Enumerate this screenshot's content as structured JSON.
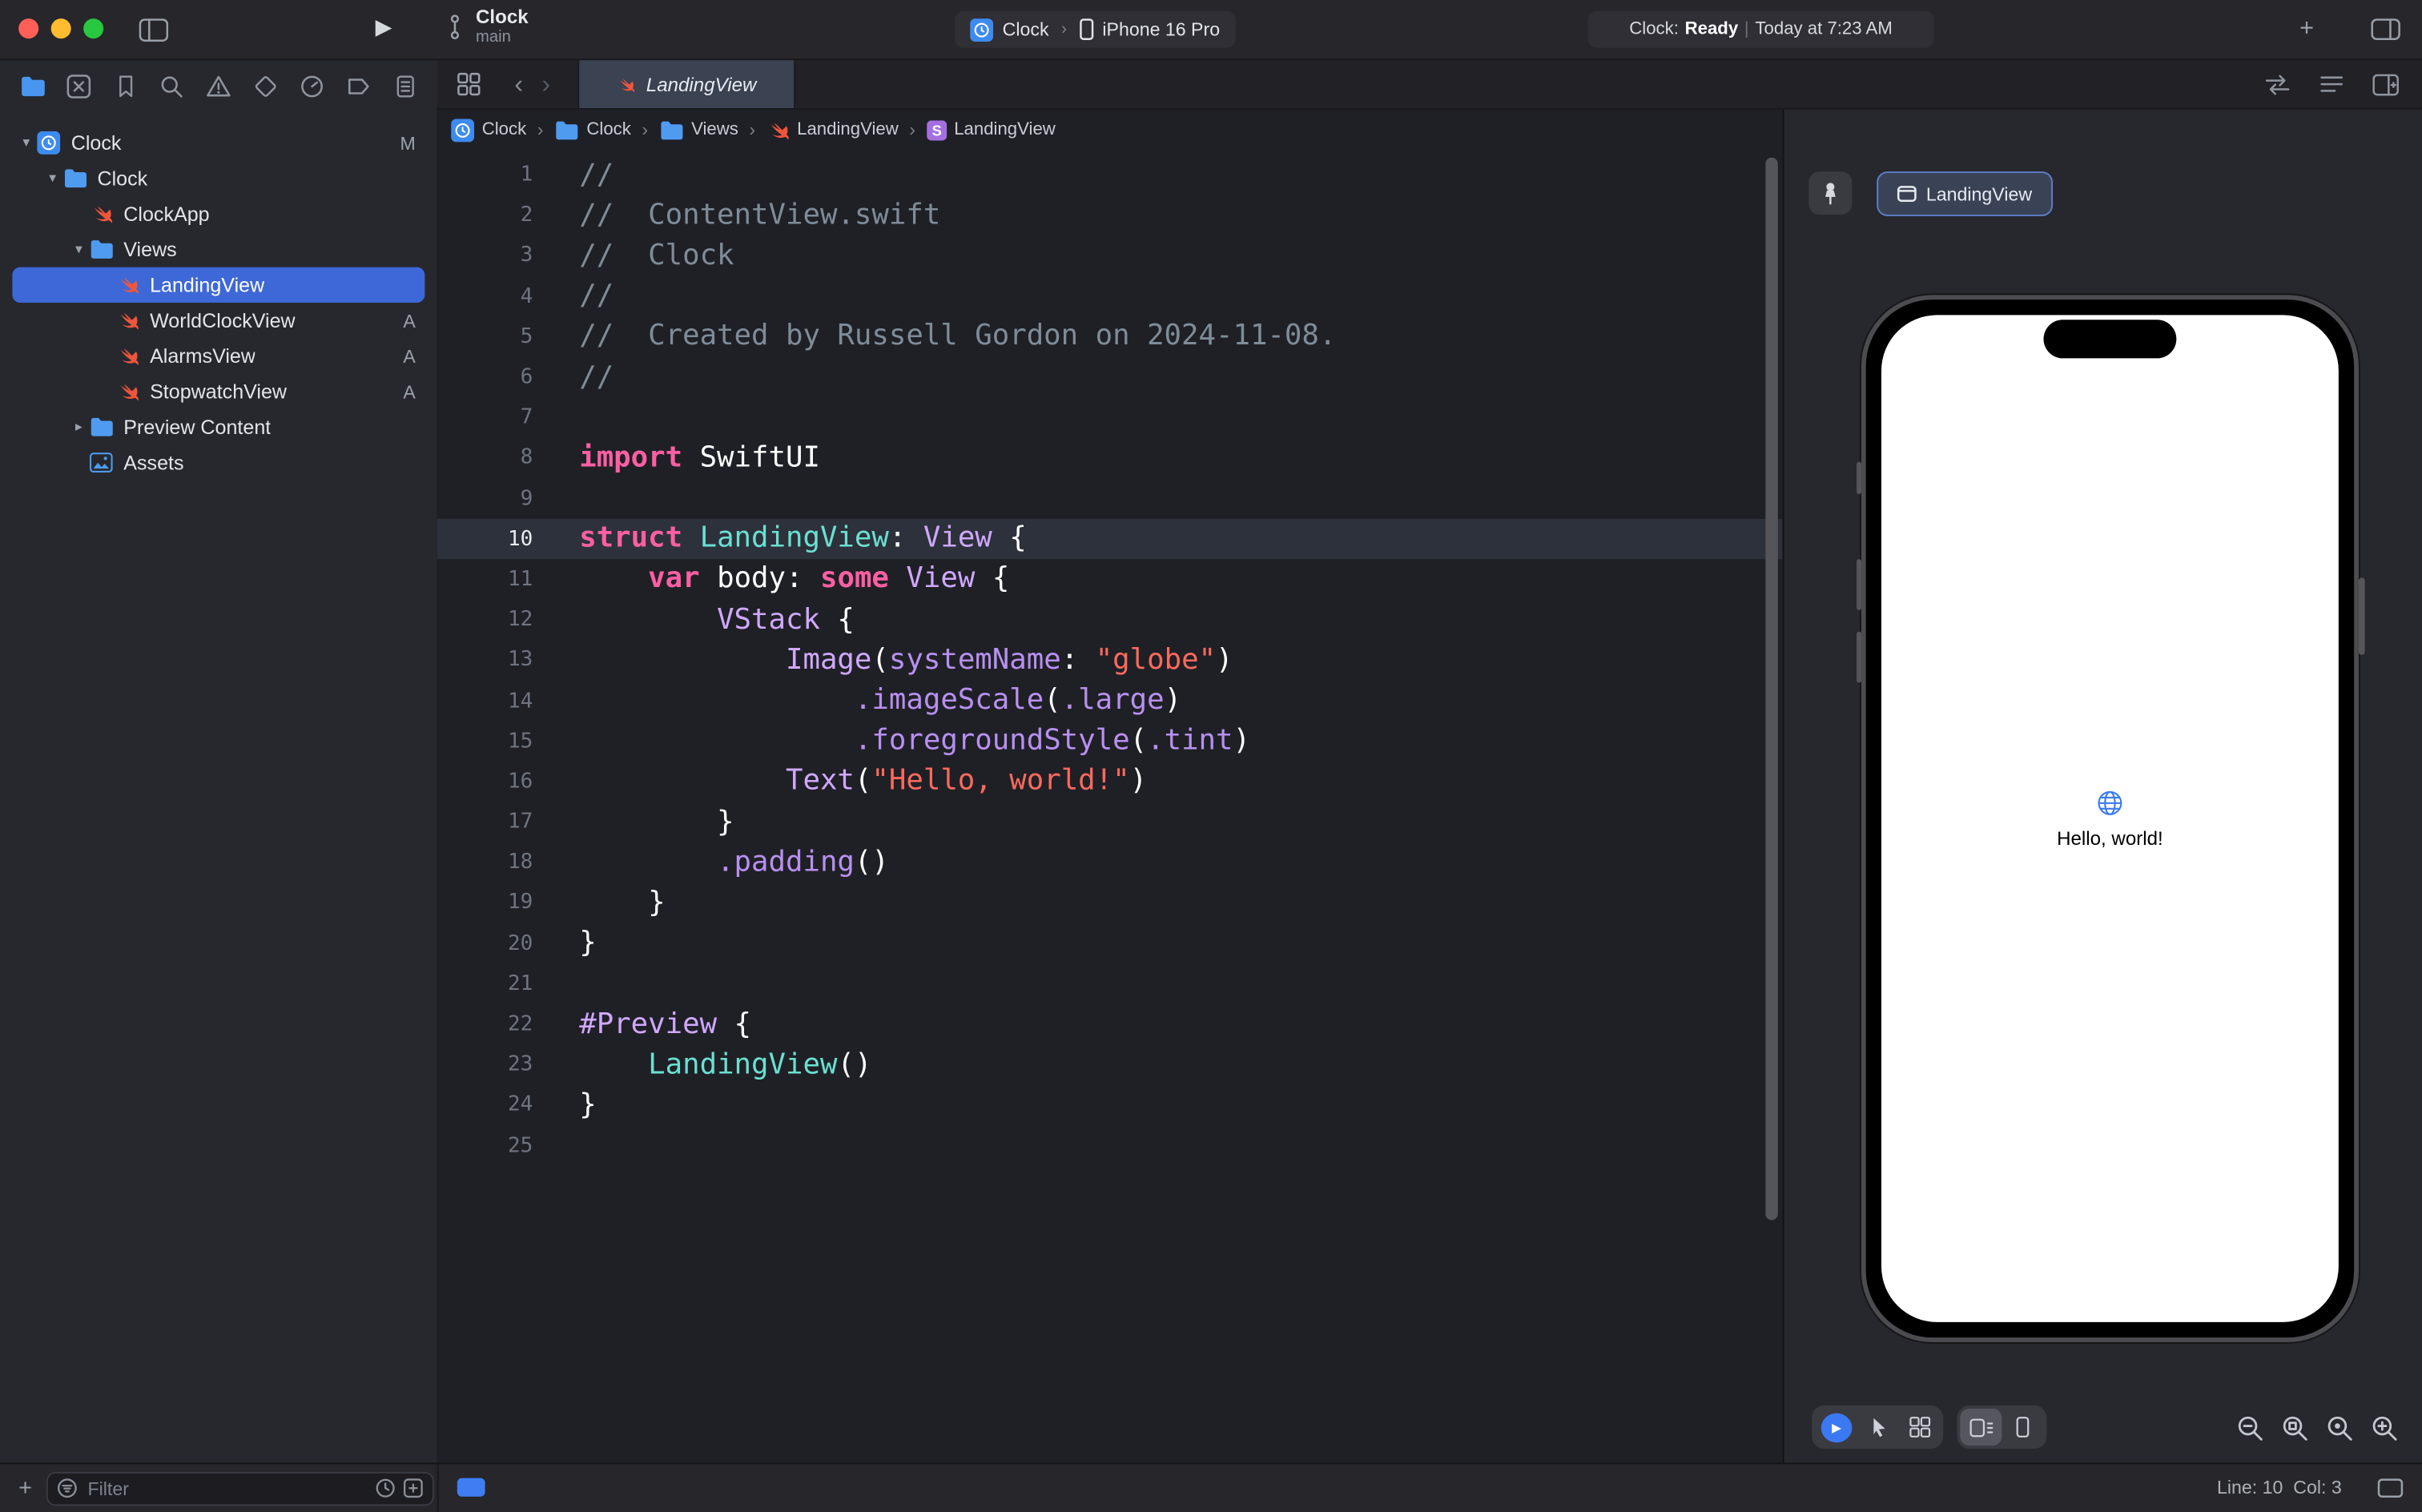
{
  "titlebar": {
    "project": "Clock",
    "branch": "main",
    "scheme_target": "Clock",
    "scheme_device": "iPhone 16 Pro",
    "status_app": "Clock:",
    "status_state": "Ready",
    "status_divider": "|",
    "status_time": "Today at 7:23 AM"
  },
  "navigator_strip": {
    "icons": [
      {
        "name": "project-navigator-icon",
        "glyph": "nav-folder",
        "active": true
      },
      {
        "name": "source-control-navigator-icon",
        "glyph": "nav-xsquare"
      },
      {
        "name": "bookmarks-navigator-icon",
        "glyph": "nav-bookmark"
      },
      {
        "name": "find-navigator-icon",
        "glyph": "nav-search"
      },
      {
        "name": "issues-navigator-icon",
        "glyph": "nav-warning"
      },
      {
        "name": "tests-navigator-icon",
        "glyph": "nav-test"
      },
      {
        "name": "debug-navigator-icon",
        "glyph": "nav-gauge"
      },
      {
        "name": "breakpoints-navigator-icon",
        "glyph": "nav-breakpoint"
      },
      {
        "name": "reports-navigator-icon",
        "glyph": "nav-report"
      }
    ]
  },
  "sidebar": {
    "items": [
      {
        "label": "Clock",
        "level": 0,
        "icon": "app",
        "chevron": "down",
        "badge": "M"
      },
      {
        "label": "Clock",
        "level": 1,
        "icon": "folder",
        "chevron": "down"
      },
      {
        "label": "ClockApp",
        "level": 2,
        "icon": "swift"
      },
      {
        "label": "Views",
        "level": 2,
        "icon": "folder",
        "chevron": "down"
      },
      {
        "label": "LandingView",
        "level": 3,
        "icon": "swift",
        "selected": true
      },
      {
        "label": "WorldClockView",
        "level": 3,
        "icon": "swift",
        "badge": "A"
      },
      {
        "label": "AlarmsView",
        "level": 3,
        "icon": "swift",
        "badge": "A"
      },
      {
        "label": "StopwatchView",
        "level": 3,
        "icon": "swift",
        "badge": "A"
      },
      {
        "label": "Preview Content",
        "level": 2,
        "icon": "folder",
        "chevron": "right"
      },
      {
        "label": "Assets",
        "level": 2,
        "icon": "assets"
      }
    ],
    "filter_placeholder": "Filter"
  },
  "editor": {
    "tab_label": "LandingView",
    "breadcrumbs": [
      {
        "label": "Clock",
        "icon": "app"
      },
      {
        "label": "Clock",
        "icon": "folder"
      },
      {
        "label": "Views",
        "icon": "folder"
      },
      {
        "label": "LandingView",
        "icon": "swift"
      },
      {
        "label": "LandingView",
        "icon": "symbol-s"
      }
    ],
    "current_line": 10,
    "lines": [
      {
        "n": 1,
        "seg": [
          [
            "com",
            "//"
          ]
        ]
      },
      {
        "n": 2,
        "seg": [
          [
            "com",
            "//  ContentView.swift"
          ]
        ]
      },
      {
        "n": 3,
        "seg": [
          [
            "com",
            "//  Clock"
          ]
        ]
      },
      {
        "n": 4,
        "seg": [
          [
            "com",
            "//"
          ]
        ]
      },
      {
        "n": 5,
        "seg": [
          [
            "com",
            "//  Created by Russell Gordon on 2024-11-08."
          ]
        ]
      },
      {
        "n": 6,
        "seg": [
          [
            "com",
            "//"
          ]
        ]
      },
      {
        "n": 7,
        "seg": []
      },
      {
        "n": 8,
        "seg": [
          [
            "kw",
            "import"
          ],
          [
            "pl",
            " SwiftUI"
          ]
        ]
      },
      {
        "n": 9,
        "seg": []
      },
      {
        "n": 10,
        "seg": [
          [
            "kw",
            "struct"
          ],
          [
            "pl",
            " "
          ],
          [
            "tp",
            "LandingView"
          ],
          [
            "pl",
            ": "
          ],
          [
            "to",
            "View"
          ],
          [
            "pl",
            " {"
          ]
        ]
      },
      {
        "n": 11,
        "seg": [
          [
            "pl",
            "    "
          ],
          [
            "kw",
            "var"
          ],
          [
            "pl",
            " body: "
          ],
          [
            "kw",
            "some"
          ],
          [
            "pl",
            " "
          ],
          [
            "to",
            "View"
          ],
          [
            "pl",
            " {"
          ]
        ]
      },
      {
        "n": 12,
        "seg": [
          [
            "pl",
            "        "
          ],
          [
            "to",
            "VStack"
          ],
          [
            "pl",
            " {"
          ]
        ]
      },
      {
        "n": 13,
        "seg": [
          [
            "pl",
            "            "
          ],
          [
            "to",
            "Image"
          ],
          [
            "pl",
            "("
          ],
          [
            "mb",
            "systemName"
          ],
          [
            "pl",
            ": "
          ],
          [
            "st",
            "\"globe\""
          ],
          [
            "pl",
            ")"
          ]
        ]
      },
      {
        "n": 14,
        "seg": [
          [
            "pl",
            "                "
          ],
          [
            "mb",
            ".imageScale"
          ],
          [
            "pl",
            "("
          ],
          [
            "mb",
            ".large"
          ],
          [
            "pl",
            ")"
          ]
        ]
      },
      {
        "n": 15,
        "seg": [
          [
            "pl",
            "                "
          ],
          [
            "mb",
            ".foregroundStyle"
          ],
          [
            "pl",
            "("
          ],
          [
            "mb",
            ".tint"
          ],
          [
            "pl",
            ")"
          ]
        ]
      },
      {
        "n": 16,
        "seg": [
          [
            "pl",
            "            "
          ],
          [
            "to",
            "Text"
          ],
          [
            "pl",
            "("
          ],
          [
            "st",
            "\"Hello, world!\""
          ],
          [
            "pl",
            ")"
          ]
        ]
      },
      {
        "n": 17,
        "seg": [
          [
            "pl",
            "        }"
          ]
        ]
      },
      {
        "n": 18,
        "seg": [
          [
            "pl",
            "        "
          ],
          [
            "mb",
            ".padding"
          ],
          [
            "pl",
            "()"
          ]
        ]
      },
      {
        "n": 19,
        "seg": [
          [
            "pl",
            "    }"
          ]
        ]
      },
      {
        "n": 20,
        "seg": [
          [
            "pl",
            "}"
          ]
        ]
      },
      {
        "n": 21,
        "seg": []
      },
      {
        "n": 22,
        "seg": [
          [
            "mc",
            "#Preview"
          ],
          [
            "pl",
            " {"
          ]
        ]
      },
      {
        "n": 23,
        "seg": [
          [
            "pl",
            "    "
          ],
          [
            "tp",
            "LandingView"
          ],
          [
            "pl",
            "()"
          ]
        ]
      },
      {
        "n": 24,
        "seg": [
          [
            "pl",
            "}"
          ]
        ]
      },
      {
        "n": 25,
        "seg": []
      }
    ]
  },
  "canvas": {
    "preview_tab": "LandingView",
    "preview_text": "Hello, world!"
  },
  "statusbar": {
    "line_col": "Line: 10  Col: 3"
  },
  "colors": {
    "selection_blue": "#3e68d8",
    "accent_blue": "#3a79f2",
    "swift_orange": "#f0553c",
    "keyword_pink": "#fc5fa3",
    "string_red": "#fc6a5d",
    "type_purple": "#d0a8ff",
    "project_type_teal": "#6be0d1",
    "comment_gray": "#7f8c98"
  }
}
